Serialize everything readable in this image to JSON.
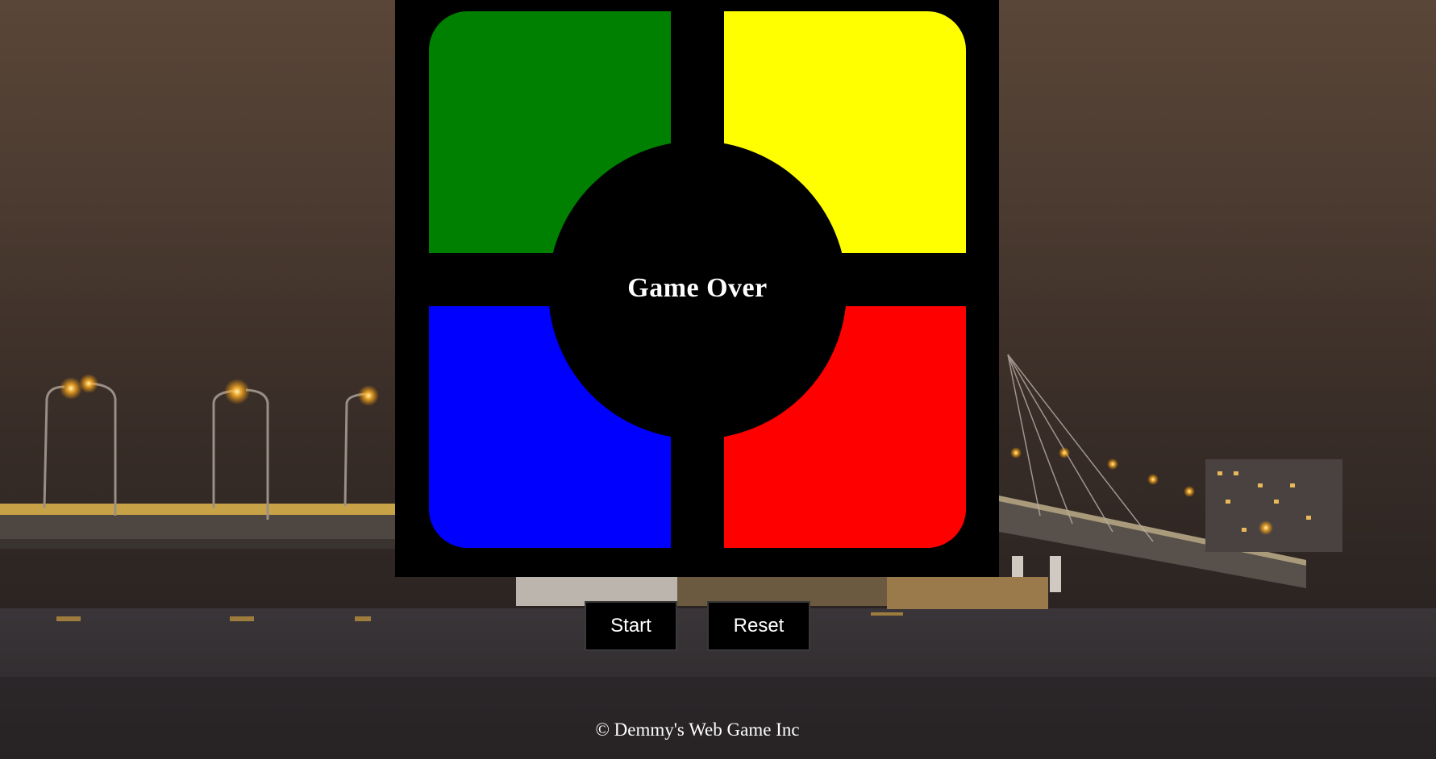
{
  "game": {
    "status": "Game Over",
    "pads": [
      {
        "name": "green",
        "color": "#008000"
      },
      {
        "name": "yellow",
        "color": "#ffff00"
      },
      {
        "name": "blue",
        "color": "#0000ff"
      },
      {
        "name": "red",
        "color": "#ff0000"
      }
    ]
  },
  "controls": {
    "start_label": "Start",
    "reset_label": "Reset"
  },
  "footer": {
    "copyright": "© Demmy's Web Game Inc"
  },
  "theme": {
    "board": "#000000",
    "text": "#ffffff"
  }
}
